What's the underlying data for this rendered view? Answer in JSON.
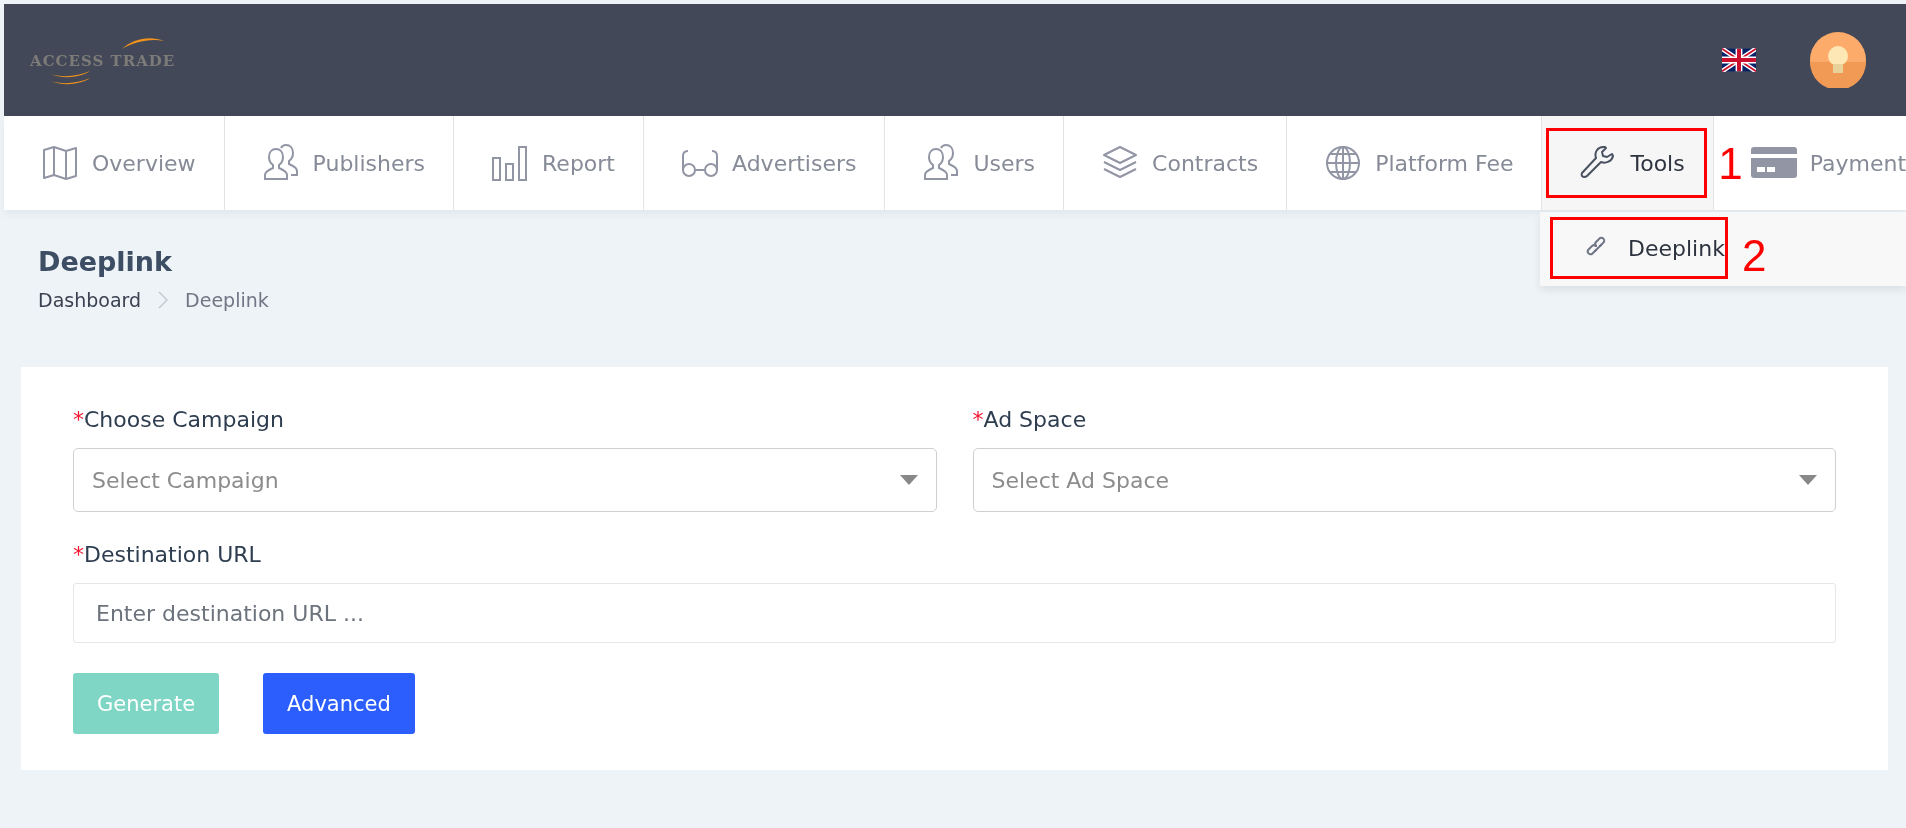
{
  "header": {
    "logo": "ACCESS TRADE"
  },
  "nav": [
    {
      "label": "Overview",
      "selected": false
    },
    {
      "label": "Publishers",
      "selected": false
    },
    {
      "label": "Report",
      "selected": false
    },
    {
      "label": "Advertisers",
      "selected": false
    },
    {
      "label": "Users",
      "selected": false
    },
    {
      "label": "Contracts",
      "selected": false
    },
    {
      "label": "Platform Fee",
      "selected": false
    },
    {
      "label": "Tools",
      "selected": true,
      "annotation": "1"
    },
    {
      "label": "Payment",
      "selected": false
    }
  ],
  "dropdown": {
    "items": [
      {
        "label": "Deeplink",
        "annotation": "2"
      }
    ]
  },
  "page": {
    "title": "Deeplink",
    "breadcrumb": [
      "Dashboard",
      "Deeplink"
    ]
  },
  "form": {
    "fields": [
      {
        "kind": "select",
        "required_mark": "*",
        "label": "Choose Campaign",
        "placeholder": "Select Campaign"
      },
      {
        "kind": "select",
        "required_mark": "*",
        "label": "Ad Space",
        "placeholder": "Select Ad Space"
      },
      {
        "kind": "text",
        "required_mark": "*",
        "label": "Destination URL",
        "placeholder": "Enter destination URL ..."
      }
    ],
    "buttons": [
      {
        "label": "Generate",
        "disabled": true
      },
      {
        "label": "Advanced",
        "disabled": false
      }
    ]
  }
}
